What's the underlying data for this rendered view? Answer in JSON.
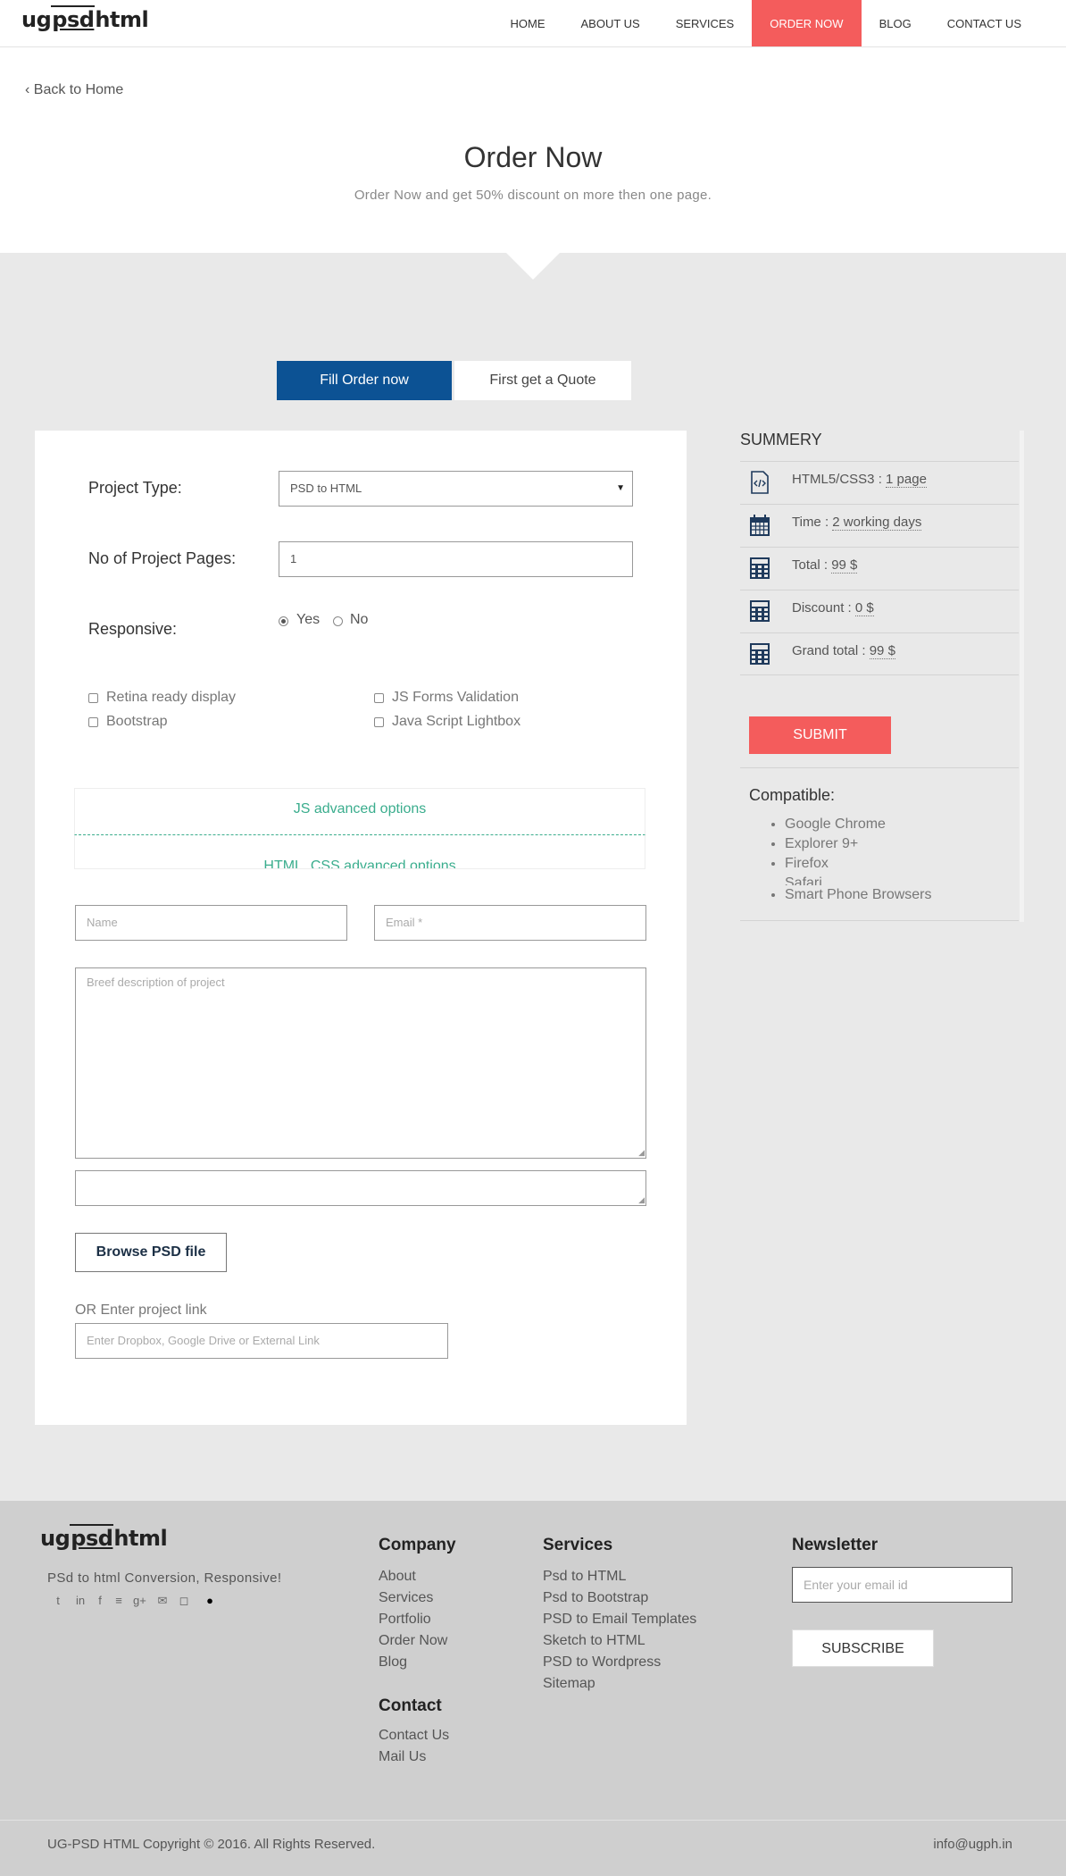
{
  "header": {
    "logo": {
      "left": "ug",
      "mid": "psd",
      "right": "html"
    },
    "nav": [
      "HOME",
      "ABOUT US",
      "SERVICES",
      "ORDER NOW",
      "BLOG",
      "CONTACT US"
    ],
    "active_nav": "ORDER NOW"
  },
  "intro": {
    "back_link": "Back to Home",
    "title": "Order Now",
    "subtitle": "Order Now and get 50% discount on more then one page."
  },
  "tabs": [
    "Fill Order now",
    "First get a Quote"
  ],
  "form": {
    "project_type_label": "Project Type:",
    "project_type_value": "PSD to HTML",
    "pages_label": "No of Project Pages:",
    "pages_value": "1",
    "responsive_label": "Responsive:",
    "responsive_yes": "Yes",
    "responsive_no": "No",
    "options": [
      "Retina ready display",
      "Bootstrap",
      "JS Forms Validation",
      "Java Script Lightbox"
    ],
    "accordion_js": "JS advanced options",
    "accordion_html": "HTML, CSS advanced options",
    "name_placeholder": "Name",
    "email_placeholder": "Email *",
    "description_placeholder": "Breef description of project",
    "browse_label": "Browse PSD file",
    "link_label": "OR Enter project link",
    "link_placeholder": "Enter Dropbox, Google Drive or External Link"
  },
  "summary": {
    "title": "SUMMERY",
    "rows": [
      {
        "label": "HTML5/CSS3 : ",
        "value": "1 page",
        "icon": "code-file-icon"
      },
      {
        "label": "Time : ",
        "value": "2 working days",
        "icon": "calendar-icon"
      },
      {
        "label": "Total : ",
        "value": "99 $",
        "icon": "calculator-icon"
      },
      {
        "label": "Discount : ",
        "value": "0 $",
        "icon": "calculator-icon"
      },
      {
        "label": "Grand total : ",
        "value": "99 $",
        "icon": "calculator-icon"
      }
    ],
    "submit": "SUBMIT",
    "compat_title": "Compatible:",
    "compat": [
      "Google Chrome",
      "Explorer 9+",
      "Firefox",
      "Safari",
      "Smart Phone Browsers"
    ]
  },
  "footer": {
    "logo": {
      "left": "ug",
      "mid": "psd",
      "right": "html"
    },
    "tagline": "PSd to html Conversion, Responsive!",
    "social": [
      "twitter-icon",
      "linkedin-icon",
      "facebook-icon",
      "stackoverflow-icon",
      "google-plus-icon",
      "mail-icon",
      "instagram-icon",
      "blogger-icon"
    ],
    "company_title": "Company",
    "company_links": [
      "About",
      "Services",
      "Portfolio",
      "Order Now",
      "Blog"
    ],
    "contact_title": "Contact",
    "contact_links": [
      "Contact Us",
      "Mail Us"
    ],
    "services_title": "Services",
    "services_links": [
      "Psd to HTML",
      "Psd to Bootstrap",
      "PSD to Email Templates",
      "Sketch to HTML",
      "PSD to Wordpress",
      "Sitemap"
    ],
    "newsletter_title": "Newsletter",
    "newsletter_placeholder": "Enter your email id",
    "subscribe": "SUBSCRIBE",
    "copyright": "UG-PSD HTML Copyright © 2016. All Rights Reserved.",
    "email": "info@ugph.in"
  },
  "colors": {
    "accent": "#f45c5c",
    "tab_blue": "#0c5294",
    "accordion_green": "#3aad8d",
    "icon_navy": "#1f3a5c"
  }
}
